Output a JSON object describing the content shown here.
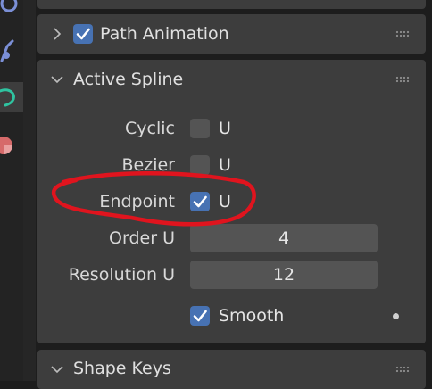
{
  "panels": {
    "path_animation": {
      "title": "Path Animation",
      "enabled": true,
      "expanded": false
    },
    "active_spline": {
      "title": "Active Spline",
      "expanded": true,
      "cyclic": {
        "label": "Cyclic",
        "option": "U",
        "checked": false
      },
      "bezier": {
        "label": "Bezier",
        "option": "U",
        "checked": false
      },
      "endpoint": {
        "label": "Endpoint",
        "option": "U",
        "checked": true
      },
      "order": {
        "label": "Order U",
        "value": "4"
      },
      "resolution": {
        "label": "Resolution U",
        "value": "12"
      },
      "smooth": {
        "label": "Smooth",
        "checked": true
      }
    },
    "shape_keys": {
      "title": "Shape Keys",
      "expanded": false
    }
  },
  "colors": {
    "checkbox_on": "#4772b3",
    "highlight_annotation": "#e0141e",
    "active_tab_icon": "#2fc3a0"
  }
}
